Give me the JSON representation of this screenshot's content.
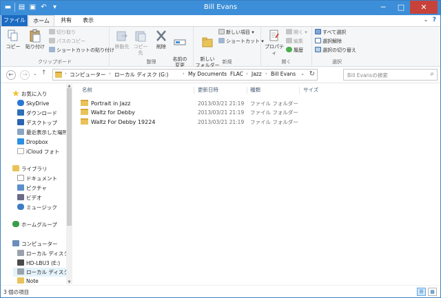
{
  "window": {
    "title": "Bill Evans",
    "accent_color": "#3c8ed8",
    "file_tab_color": "#1d6cc3"
  },
  "qat": {
    "icons": [
      "folder-icon",
      "properties-icon",
      "new-folder-icon",
      "undo-icon",
      "customize-qat-icon"
    ]
  },
  "ribbon_tabs": [
    "ファイル",
    "ホーム",
    "共有",
    "表示"
  ],
  "ribbon_controls": {
    "expand": "⌄",
    "help": "?"
  },
  "ribbon": {
    "clipboard": {
      "label": "クリップボード",
      "copy": "コピー",
      "paste": "貼り付け",
      "cut": "切り取り",
      "copy_path": "パスのコピー",
      "paste_shortcut": "ショートカットの貼り付け"
    },
    "organize": {
      "label": "整理",
      "move_to": "移動先",
      "copy_to": "コピー先",
      "delete": "削除",
      "rename": "名前の\n変更"
    },
    "new": {
      "label": "新規",
      "new_folder": "新しい\nフォルダー",
      "new_item": "新しい項目",
      "shortcut": "ショートカット"
    },
    "open": {
      "label": "開く",
      "properties": "プロパティ",
      "open": "開く",
      "edit": "編集",
      "history": "履歴"
    },
    "select": {
      "label": "選択",
      "select_all": "すべて選択",
      "select_none": "選択解除",
      "invert": "選択の切り替え"
    }
  },
  "nav": {
    "back": "←",
    "forward": "→",
    "recent": "⌄",
    "up": "↑",
    "breadcrumbs": [
      "コンピューター",
      "ローカル ディスク (G:)",
      "My Documents",
      "FLAC",
      "Jazz",
      "Bill Evans"
    ],
    "search_placeholder": "Bill Evansの検索"
  },
  "navpane": {
    "favorites": {
      "header": "お気に入り",
      "items": [
        "SkyDrive",
        "ダウンロード",
        "デスクトップ",
        "最近表示した場所",
        "Dropbox",
        "iCloud フォト"
      ]
    },
    "libraries": {
      "header": "ライブラリ",
      "items": [
        "ドキュメント",
        "ピクチャ",
        "ビデオ",
        "ミュージック"
      ]
    },
    "homegroup": "ホームグループ",
    "computer": {
      "header": "コンピューター",
      "items": [
        "ローカル ディスク (C",
        "HD-LBU3 (E:)",
        "ローカル ディスク (G",
        "Note"
      ]
    }
  },
  "columns": [
    "名前",
    "更新日時",
    "種類",
    "サイズ"
  ],
  "files": [
    {
      "name": "Portrait in Jazz",
      "date": "2013/03/21 21:19",
      "type": "ファイル フォルダー"
    },
    {
      "name": "Waltz for Debby",
      "date": "2013/03/21 21:19",
      "type": "ファイル フォルダー"
    },
    {
      "name": "Waltz For Debby 19224",
      "date": "2013/03/21 21:19",
      "type": "ファイル フォルダー"
    }
  ],
  "status": {
    "count": "3 個の項目"
  }
}
